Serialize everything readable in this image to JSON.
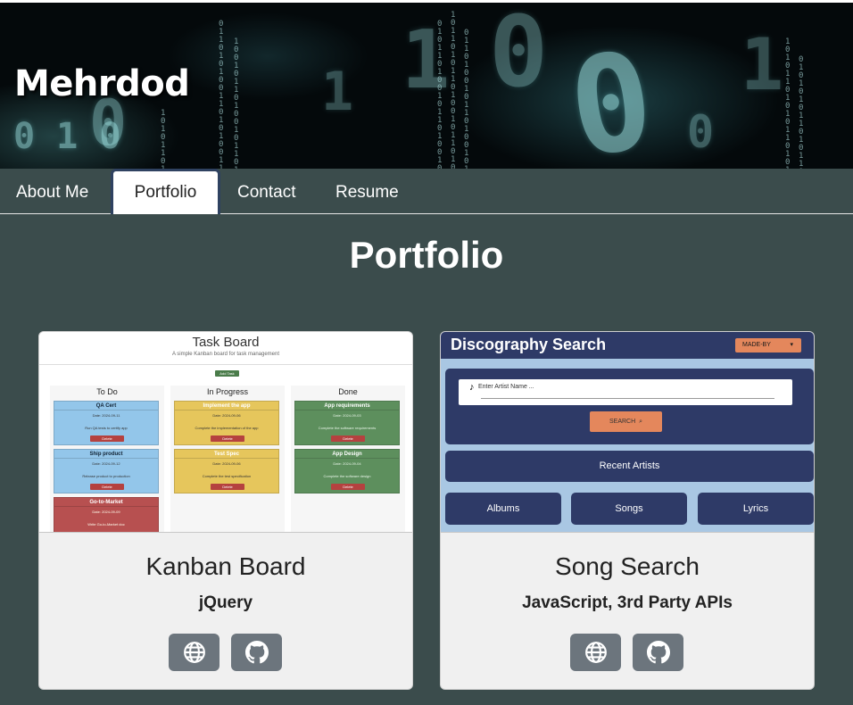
{
  "header": {
    "site_title": "Mehrdod"
  },
  "nav": {
    "items": [
      {
        "label": "About Me",
        "active": false
      },
      {
        "label": "Portfolio",
        "active": true
      },
      {
        "label": "Contact",
        "active": false
      },
      {
        "label": "Resume",
        "active": false
      }
    ]
  },
  "main": {
    "heading": "Portfolio"
  },
  "projects": [
    {
      "title": "Kanban Board",
      "tech": "jQuery",
      "buttons": [
        {
          "icon": "globe-icon"
        },
        {
          "icon": "github-icon"
        }
      ],
      "preview": {
        "title": "Task Board",
        "subtitle": "A simple Kanban board for task management",
        "add_label": "Add Task",
        "columns": [
          {
            "name": "To Do",
            "tasks": [
              {
                "title": "QA Cert",
                "date": "Date: 2024-09-11",
                "desc": "Run QA tests to certify app",
                "color": "blue"
              },
              {
                "title": "Ship product",
                "date": "Date: 2024-09-12",
                "desc": "Release product to production",
                "color": "blue"
              },
              {
                "title": "Go-to-Market",
                "date": "Date: 2024-09-09",
                "desc": "Write Go-to-Market doc",
                "color": "red"
              }
            ]
          },
          {
            "name": "In Progress",
            "tasks": [
              {
                "title": "Implement the app",
                "date": "Date: 2024-09-06",
                "desc": "Complete the implementation of the app",
                "color": "yellow"
              },
              {
                "title": "Test Spec",
                "date": "Date: 2024-09-06",
                "desc": "Complete the test specification",
                "color": "yellow"
              }
            ]
          },
          {
            "name": "Done",
            "tasks": [
              {
                "title": "App requirements",
                "date": "Date: 2024-09-03",
                "desc": "Complete the software requirements",
                "color": "green"
              },
              {
                "title": "App Design",
                "date": "Date: 2024-09-04",
                "desc": "Complete the software design",
                "color": "green"
              }
            ]
          }
        ],
        "delete_label": "Delete"
      }
    },
    {
      "title": "Song Search",
      "tech": "JavaScript, 3rd Party APIs",
      "buttons": [
        {
          "icon": "globe-icon"
        },
        {
          "icon": "github-icon"
        }
      ],
      "preview": {
        "title": "Discography Search",
        "made_by": "MADE-BY",
        "input_placeholder": "Enter Artist Name ...",
        "search_label": "SEARCH",
        "recent_label": "Recent Artists",
        "tabs": [
          "Albums",
          "Songs",
          "Lyrics"
        ]
      }
    }
  ],
  "colors": {
    "page_bg": "#3b4c4c",
    "nav_active_border": "#2f4261",
    "button_bg": "#6c757d",
    "card_bg": "#f0f0f0",
    "disco_navy": "#2e3a67",
    "disco_orange": "#e4875c"
  }
}
